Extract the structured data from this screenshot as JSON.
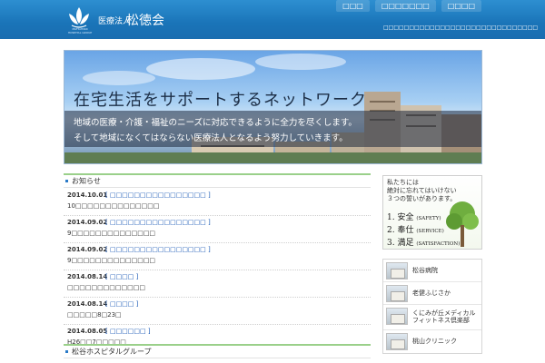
{
  "header": {
    "corp_type": "医療法人",
    "corp_name": "松徳会",
    "logo_sub": "MATSUTANI HOSPITAL GROUP",
    "nav": [
      "□□□",
      "□□□□□□□",
      "□□□□"
    ],
    "strip": "□□□□□□□□□□□□□□□□□□□□□□□□□□□□□□□□□□"
  },
  "banner": {
    "title": "在宅生活をサポートするネットワーク",
    "line1": "地域の医療・介護・福祉のニーズに対応できるように全力を尽くします。",
    "line2": "そして地域になくてはならない医療法人となるよう努力していきます。"
  },
  "news": {
    "heading": "お知らせ",
    "items": [
      {
        "date": "2014.10.01",
        "category": "[ □□□□□□□□□□□□□□□□ ]",
        "text": "10□□□□□□□□□□□□□□"
      },
      {
        "date": "2014.09.02",
        "category": "[ □□□□□□□□□□□□□□□□ ]",
        "text": "9□□□□□□□□□□□□□□"
      },
      {
        "date": "2014.09.02",
        "category": "[ □□□□□□□□□□□□□□□□ ]",
        "text": "9□□□□□□□□□□□□□□"
      },
      {
        "date": "2014.08.14",
        "category": "[ □□□□ ]",
        "text": "□□□□□□□□□□□□□"
      },
      {
        "date": "2014.08.14",
        "category": "[ □□□□ ]",
        "text": "□□□□□8□23□"
      },
      {
        "date": "2014.08.05",
        "category": "[ □□□□□□ ]",
        "text": "H26□□7□□□□□"
      }
    ]
  },
  "group": {
    "heading": "松谷ホスピタルグループ"
  },
  "vows": {
    "intro": [
      "私たちには",
      "絶対に忘れてはいけない",
      "３つの誓いがあります。"
    ],
    "items": [
      {
        "label": "1. 安全",
        "en": "(SAFETY)"
      },
      {
        "label": "2. 奉仕",
        "en": "(SERVICE)"
      },
      {
        "label": "3. 満足",
        "en": "(SATISFACTION)"
      }
    ]
  },
  "facilities": [
    {
      "label": "松谷病院"
    },
    {
      "label": "老健ふじさか"
    },
    {
      "label": "くにみが丘メディカル\nフィットネス倶楽部"
    },
    {
      "label": "桃山クリニック"
    }
  ]
}
